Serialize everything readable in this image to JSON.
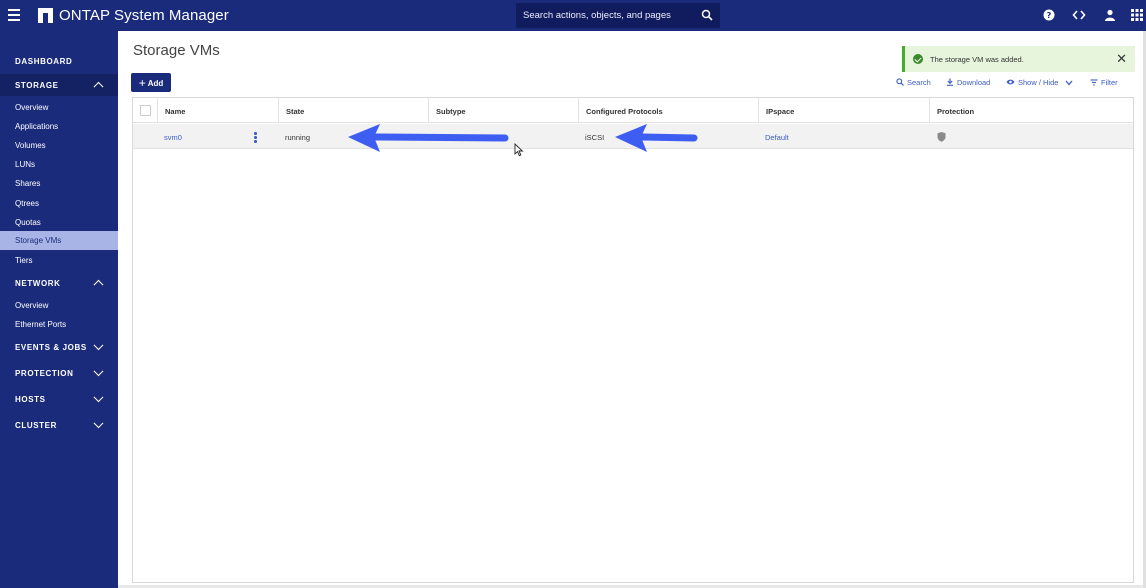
{
  "app": {
    "title": "ONTAP System Manager"
  },
  "search": {
    "placeholder": "Search actions, objects, and pages"
  },
  "sidebar": {
    "dashboard": "DASHBOARD",
    "storage": {
      "label": "STORAGE",
      "items": [
        "Overview",
        "Applications",
        "Volumes",
        "LUNs",
        "Shares",
        "Qtrees",
        "Quotas",
        "Storage VMs",
        "Tiers"
      ],
      "selected": "Storage VMs"
    },
    "network": {
      "label": "NETWORK",
      "items": [
        "Overview",
        "Ethernet Ports"
      ]
    },
    "events_jobs": "EVENTS & JOBS",
    "protection": "PROTECTION",
    "hosts": "HOSTS",
    "cluster": "CLUSTER"
  },
  "page": {
    "title": "Storage VMs",
    "add_label": "Add"
  },
  "toast": {
    "message": "The storage VM was added."
  },
  "toolbar": {
    "search": "Search",
    "download": "Download",
    "show_hide": "Show / Hide",
    "filter": "Filter"
  },
  "table": {
    "columns": [
      "Name",
      "State",
      "Subtype",
      "Configured Protocols",
      "IPspace",
      "Protection"
    ],
    "rows": [
      {
        "name": "svm0",
        "state": "running",
        "subtype": "",
        "protocols": "iSCSI",
        "ipspace": "Default"
      }
    ]
  },
  "colors": {
    "nav": "#1b2b7c",
    "nav_selected": "#a9b4e6",
    "link": "#3c5cc4",
    "toast_bg": "#e6f5dc",
    "toast_accent": "#4caa2a",
    "arrow": "#3d5ef0"
  }
}
